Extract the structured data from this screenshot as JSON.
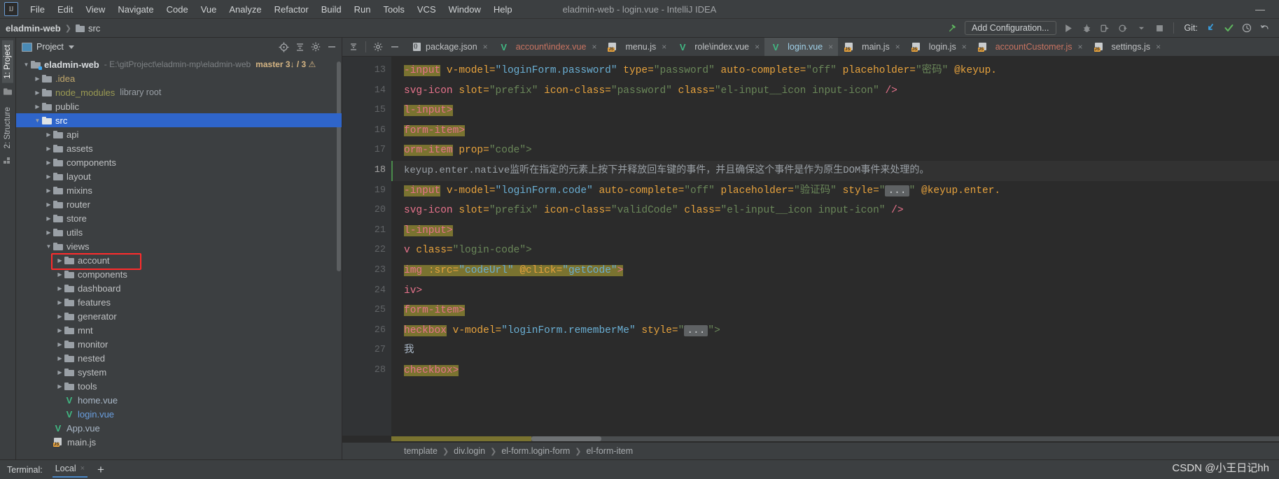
{
  "window": {
    "title": "eladmin-web - login.vue - IntelliJ IDEA",
    "logo": "IJ",
    "minimize": "—"
  },
  "menubar": {
    "items": [
      "File",
      "Edit",
      "View",
      "Navigate",
      "Code",
      "Vue",
      "Analyze",
      "Refactor",
      "Build",
      "Run",
      "Tools",
      "VCS",
      "Window",
      "Help"
    ]
  },
  "navbar": {
    "crumbs": [
      "eladmin-web",
      "src"
    ],
    "add_configuration": "Add Configuration...",
    "git_label": "Git:",
    "icons": {
      "build": "hammer-icon",
      "run": "run-icon",
      "debug": "debug-icon",
      "run_with_coverage": "run-coverage-icon",
      "profile": "profile-icon",
      "stop": "stop-icon",
      "update_project": "update-project-icon",
      "commit": "commit-icon",
      "history": "history-icon",
      "rollback": "rollback-icon"
    }
  },
  "toolstrip": {
    "tabs": [
      "1: Project",
      "2: Structure"
    ]
  },
  "project": {
    "title": "Project",
    "root": {
      "label": "eladmin-web",
      "path": "- E:\\gitProject\\eladmin-mp\\eladmin-web",
      "git": "master 3↓ / 3 ⚠"
    },
    "tree": [
      {
        "label": "eladmin-web",
        "depth": 0,
        "icon": "module-folder-icon",
        "arrow": "open",
        "style": "boldw",
        "suffix_path": "- E:\\gitProject\\eladmin-mp\\eladmin-web",
        "suffix_git": "master 3↓ / 3 ⚠"
      },
      {
        "label": ".idea",
        "depth": 1,
        "icon": "folder-icon",
        "arrow": "closed",
        "style": "yellow"
      },
      {
        "label": "node_modules",
        "depth": 1,
        "icon": "folder-icon",
        "arrow": "closed",
        "style": "olive",
        "suffix_note": "library root"
      },
      {
        "label": "public",
        "depth": 1,
        "icon": "folder-icon",
        "arrow": "closed",
        "style": "plain"
      },
      {
        "label": "src",
        "depth": 1,
        "icon": "folder-icon",
        "arrow": "open",
        "style": "plain",
        "selected": true
      },
      {
        "label": "api",
        "depth": 2,
        "icon": "folder-icon",
        "arrow": "closed",
        "style": "plain"
      },
      {
        "label": "assets",
        "depth": 2,
        "icon": "folder-icon",
        "arrow": "closed",
        "style": "plain"
      },
      {
        "label": "components",
        "depth": 2,
        "icon": "folder-icon",
        "arrow": "closed",
        "style": "plain"
      },
      {
        "label": "layout",
        "depth": 2,
        "icon": "folder-icon",
        "arrow": "closed",
        "style": "plain"
      },
      {
        "label": "mixins",
        "depth": 2,
        "icon": "folder-icon",
        "arrow": "closed",
        "style": "plain"
      },
      {
        "label": "router",
        "depth": 2,
        "icon": "folder-icon",
        "arrow": "closed",
        "style": "plain"
      },
      {
        "label": "store",
        "depth": 2,
        "icon": "folder-icon",
        "arrow": "closed",
        "style": "plain"
      },
      {
        "label": "utils",
        "depth": 2,
        "icon": "folder-icon",
        "arrow": "closed",
        "style": "plain"
      },
      {
        "label": "views",
        "depth": 2,
        "icon": "folder-icon",
        "arrow": "open",
        "style": "plain"
      },
      {
        "label": "account",
        "depth": 3,
        "icon": "folder-icon",
        "arrow": "closed",
        "style": "plain",
        "highlight_box": true
      },
      {
        "label": "components",
        "depth": 3,
        "icon": "folder-icon",
        "arrow": "closed",
        "style": "plain"
      },
      {
        "label": "dashboard",
        "depth": 3,
        "icon": "folder-icon",
        "arrow": "closed",
        "style": "plain"
      },
      {
        "label": "features",
        "depth": 3,
        "icon": "folder-icon",
        "arrow": "closed",
        "style": "plain"
      },
      {
        "label": "generator",
        "depth": 3,
        "icon": "folder-icon",
        "arrow": "closed",
        "style": "plain"
      },
      {
        "label": "mnt",
        "depth": 3,
        "icon": "folder-icon",
        "arrow": "closed",
        "style": "plain"
      },
      {
        "label": "monitor",
        "depth": 3,
        "icon": "folder-icon",
        "arrow": "closed",
        "style": "plain"
      },
      {
        "label": "nested",
        "depth": 3,
        "icon": "folder-icon",
        "arrow": "closed",
        "style": "plain"
      },
      {
        "label": "system",
        "depth": 3,
        "icon": "folder-icon",
        "arrow": "closed",
        "style": "plain"
      },
      {
        "label": "tools",
        "depth": 3,
        "icon": "folder-icon",
        "arrow": "closed",
        "style": "plain"
      },
      {
        "label": "home.vue",
        "depth": 3,
        "icon": "vue-icon",
        "arrow": "none",
        "style": "vuefile"
      },
      {
        "label": "login.vue",
        "depth": 3,
        "icon": "vue-icon",
        "arrow": "none",
        "style": "bluefile"
      },
      {
        "label": "App.vue",
        "depth": 2,
        "icon": "vue-icon",
        "arrow": "none",
        "style": "vuefile"
      },
      {
        "label": "main.js",
        "depth": 2,
        "icon": "js-icon",
        "arrow": "none",
        "style": "plain"
      }
    ]
  },
  "editor": {
    "tabs": [
      {
        "label": "package.json",
        "icon": "json-icon",
        "color": "plain",
        "active": false
      },
      {
        "label": "account\\index.vue",
        "icon": "vue-icon",
        "color": "red",
        "active": false
      },
      {
        "label": "menu.js",
        "icon": "js-icon",
        "color": "plain",
        "active": false
      },
      {
        "label": "role\\index.vue",
        "icon": "vue-icon",
        "color": "plain",
        "active": false
      },
      {
        "label": "login.vue",
        "icon": "vue-icon",
        "color": "active",
        "active": true
      },
      {
        "label": "main.js",
        "icon": "js-icon",
        "color": "plain",
        "active": false
      },
      {
        "label": "login.js",
        "icon": "js-icon",
        "color": "plain",
        "active": false
      },
      {
        "label": "accountCustomer.js",
        "icon": "js-icon",
        "color": "red",
        "active": false
      },
      {
        "label": "settings.js",
        "icon": "js-icon",
        "color": "plain",
        "active": false
      }
    ],
    "close_glyph": "×",
    "line_numbers": [
      "13",
      "14",
      "15",
      "16",
      "17",
      "18",
      "19",
      "20",
      "21",
      "22",
      "23",
      "24",
      "25",
      "26",
      "27",
      "28"
    ],
    "current_line": "18",
    "lines": [
      {
        "n": "13",
        "segments": [
          {
            "t": "-input",
            "c": "sel-tag"
          },
          {
            "t": " ",
            "c": "plain"
          },
          {
            "t": "v-model=",
            "c": "attr"
          },
          {
            "t": "\"loginForm.password\"",
            "c": "val"
          },
          {
            "t": " ",
            "c": "plain"
          },
          {
            "t": "type=",
            "c": "attr"
          },
          {
            "t": "\"password\"",
            "c": "str"
          },
          {
            "t": " ",
            "c": "plain"
          },
          {
            "t": "auto-complete=",
            "c": "attr"
          },
          {
            "t": "\"off\"",
            "c": "str"
          },
          {
            "t": " ",
            "c": "plain"
          },
          {
            "t": "placeholder=",
            "c": "attr"
          },
          {
            "t": "\"密码\"",
            "c": "str"
          },
          {
            "t": " ",
            "c": "plain"
          },
          {
            "t": "@keyup.",
            "c": "attr"
          }
        ]
      },
      {
        "n": "14",
        "segments": [
          {
            "t": "svg-icon",
            "c": "tag"
          },
          {
            "t": " ",
            "c": "plain"
          },
          {
            "t": "slot=",
            "c": "attr"
          },
          {
            "t": "\"prefix\"",
            "c": "str"
          },
          {
            "t": " ",
            "c": "plain"
          },
          {
            "t": "icon-class=",
            "c": "attr"
          },
          {
            "t": "\"password\"",
            "c": "str"
          },
          {
            "t": " ",
            "c": "plain"
          },
          {
            "t": "class=",
            "c": "attr"
          },
          {
            "t": "\"el-input__icon input-icon\"",
            "c": "str"
          },
          {
            "t": " />",
            "c": "tag"
          }
        ]
      },
      {
        "n": "15",
        "segments": [
          {
            "t": "l-input>",
            "c": "sel-tag"
          }
        ]
      },
      {
        "n": "16",
        "segments": [
          {
            "t": "form-item>",
            "c": "sel-tag"
          }
        ]
      },
      {
        "n": "17",
        "segments": [
          {
            "t": "orm-item",
            "c": "sel-tag"
          },
          {
            "t": " ",
            "c": "plain"
          },
          {
            "t": "prop=",
            "c": "attr"
          },
          {
            "t": "\"code\">",
            "c": "str"
          }
        ]
      },
      {
        "n": "18",
        "doc": "keyup.enter.native监听在指定的元素上按下并释放回车键的事件，并且确保这个事件是作为原生DOM事件来处理的。"
      },
      {
        "n": "19",
        "segments": [
          {
            "t": "-input",
            "c": "sel-tag"
          },
          {
            "t": " ",
            "c": "plain"
          },
          {
            "t": "v-model=",
            "c": "attr"
          },
          {
            "t": "\"loginForm.code\"",
            "c": "val"
          },
          {
            "t": " ",
            "c": "plain"
          },
          {
            "t": "auto-complete=",
            "c": "attr"
          },
          {
            "t": "\"off\"",
            "c": "str"
          },
          {
            "t": " ",
            "c": "plain"
          },
          {
            "t": "placeholder=",
            "c": "attr"
          },
          {
            "t": "\"验证码\"",
            "c": "str"
          },
          {
            "t": " ",
            "c": "plain"
          },
          {
            "t": "style=",
            "c": "attr"
          },
          {
            "t": "\"",
            "c": "str"
          },
          {
            "t": "...",
            "c": "ellipsis"
          },
          {
            "t": "\"",
            "c": "str"
          },
          {
            "t": " ",
            "c": "plain"
          },
          {
            "t": "@keyup.enter.",
            "c": "attr"
          }
        ]
      },
      {
        "n": "20",
        "segments": [
          {
            "t": "svg-icon",
            "c": "tag"
          },
          {
            "t": " ",
            "c": "plain"
          },
          {
            "t": "slot=",
            "c": "attr"
          },
          {
            "t": "\"prefix\"",
            "c": "str"
          },
          {
            "t": " ",
            "c": "plain"
          },
          {
            "t": "icon-class=",
            "c": "attr"
          },
          {
            "t": "\"validCode\"",
            "c": "str"
          },
          {
            "t": " ",
            "c": "plain"
          },
          {
            "t": "class=",
            "c": "attr"
          },
          {
            "t": "\"el-input__icon input-icon\"",
            "c": "str"
          },
          {
            "t": " />",
            "c": "tag"
          }
        ]
      },
      {
        "n": "21",
        "segments": [
          {
            "t": "l-input>",
            "c": "sel-tag"
          }
        ]
      },
      {
        "n": "22",
        "segments": [
          {
            "t": "v",
            "c": "tag"
          },
          {
            "t": " ",
            "c": "plain"
          },
          {
            "t": "class=",
            "c": "attr"
          },
          {
            "t": "\"login-code\">",
            "c": "str"
          }
        ]
      },
      {
        "n": "23",
        "segments": [
          {
            "t": "img",
            "c": "sel-tag"
          },
          {
            "t": " ",
            "c": "sel-plain"
          },
          {
            "t": ":src=",
            "c": "sel-attr"
          },
          {
            "t": "\"codeUrl\"",
            "c": "sel-val"
          },
          {
            "t": " ",
            "c": "sel-plain"
          },
          {
            "t": "@click=",
            "c": "sel-attr"
          },
          {
            "t": "\"getCode\"",
            "c": "sel-val"
          },
          {
            "t": ">",
            "c": "sel-tag"
          }
        ]
      },
      {
        "n": "24",
        "segments": [
          {
            "t": "iv>",
            "c": "tag"
          }
        ]
      },
      {
        "n": "25",
        "segments": [
          {
            "t": "form-item>",
            "c": "sel-tag"
          }
        ]
      },
      {
        "n": "26",
        "segments": [
          {
            "t": "heckbox",
            "c": "sel-tag"
          },
          {
            "t": " ",
            "c": "plain"
          },
          {
            "t": "v-model=",
            "c": "attr"
          },
          {
            "t": "\"loginForm.rememberMe\"",
            "c": "val"
          },
          {
            "t": " ",
            "c": "plain"
          },
          {
            "t": "style=",
            "c": "attr"
          },
          {
            "t": "\"",
            "c": "str"
          },
          {
            "t": "...",
            "c": "ellipsis"
          },
          {
            "t": "\">",
            "c": "str"
          }
        ]
      },
      {
        "n": "27",
        "segments": [
          {
            "t": "我",
            "c": "plain"
          }
        ]
      },
      {
        "n": "28",
        "segments": [
          {
            "t": "checkbox>",
            "c": "sel-tag"
          }
        ]
      }
    ],
    "breadcrumbs": [
      "template",
      "div.login",
      "el-form.login-form",
      "el-form-item"
    ]
  },
  "statusbar": {
    "terminal_label": "Terminal:",
    "terminal_tab": "Local",
    "close_glyph": "×",
    "add_glyph": "+"
  },
  "watermark": "CSDN @小王日记hh",
  "colors": {
    "accent_blue": "#2f65ca",
    "tab_active": "#4e5254",
    "editor_bg": "#2b2b2b",
    "panel_bg": "#3c3f41",
    "vue_green": "#41b883",
    "highlight_box": "#ff2c2c",
    "selection_olive": "#7a7330"
  }
}
